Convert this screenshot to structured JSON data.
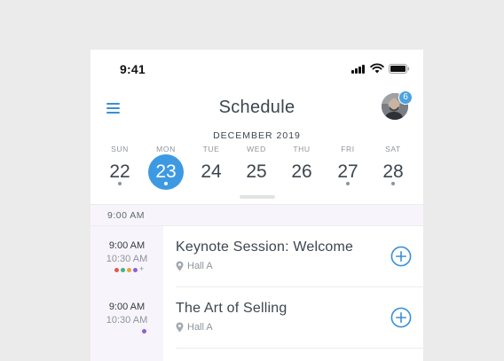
{
  "status": {
    "time": "9:41"
  },
  "header": {
    "title": "Schedule",
    "notification_count": "6"
  },
  "calendar": {
    "month": "DECEMBER 2019",
    "days": [
      {
        "dow": "SUN",
        "num": "22",
        "selected": false,
        "has_events": true
      },
      {
        "dow": "MON",
        "num": "23",
        "selected": true,
        "has_events": true
      },
      {
        "dow": "TUE",
        "num": "24",
        "selected": false,
        "has_events": false
      },
      {
        "dow": "WED",
        "num": "25",
        "selected": false,
        "has_events": false
      },
      {
        "dow": "THU",
        "num": "26",
        "selected": false,
        "has_events": false
      },
      {
        "dow": "FRI",
        "num": "27",
        "selected": false,
        "has_events": true
      },
      {
        "dow": "SAT",
        "num": "28",
        "selected": false,
        "has_events": true
      }
    ]
  },
  "agenda": {
    "section_time": "9:00 AM",
    "sessions": [
      {
        "start": "9:00 AM",
        "end": "10:30 AM",
        "title": "Keynote Session: Welcome",
        "location": "Hall A",
        "tag_colors": [
          "#e2574c",
          "#3fb38a",
          "#e8a23a",
          "#8f5fd6"
        ],
        "more_tags": "+"
      },
      {
        "start": "9:00 AM",
        "end": "10:30 AM",
        "title": "The Art of Selling",
        "location": "Hall A",
        "tag_colors": [
          "#8f5fd6"
        ],
        "more_tags": ""
      }
    ]
  },
  "colors": {
    "accent": "#3d9ae2",
    "icon_blue": "#3a8fd5",
    "muted": "#8d949b",
    "section_bg": "#f7f5fb"
  }
}
